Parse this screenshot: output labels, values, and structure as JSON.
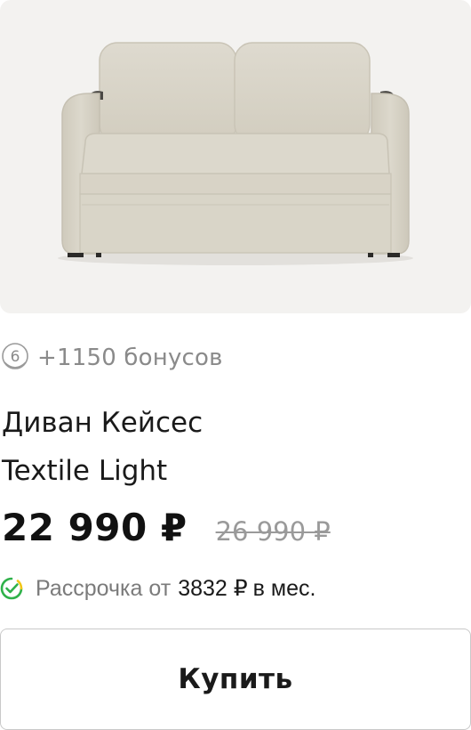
{
  "product": {
    "image_alt": "sofa",
    "bonus": {
      "icon": "bonus-coin-icon",
      "icon_digit": "6",
      "text": "+1150 бонусов"
    },
    "title_line1": "Диван Кейсес",
    "title_line2": "Textile Light",
    "price": "22 990 ₽",
    "old_price": "26 990 ₽",
    "installment": {
      "icon": "check-icon",
      "prefix": "Рассрочка от",
      "amount": "3832 ₽",
      "suffix": "в мес."
    },
    "buy_label": "Купить"
  },
  "colors": {
    "image_bg": "#f3f2f0",
    "sofa_fabric": "#ddd9cc",
    "muted_text": "#8a8a8a",
    "check_green": "#2fb14a",
    "check_yellow": "#f2c617",
    "button_border": "#c9c9c9"
  }
}
